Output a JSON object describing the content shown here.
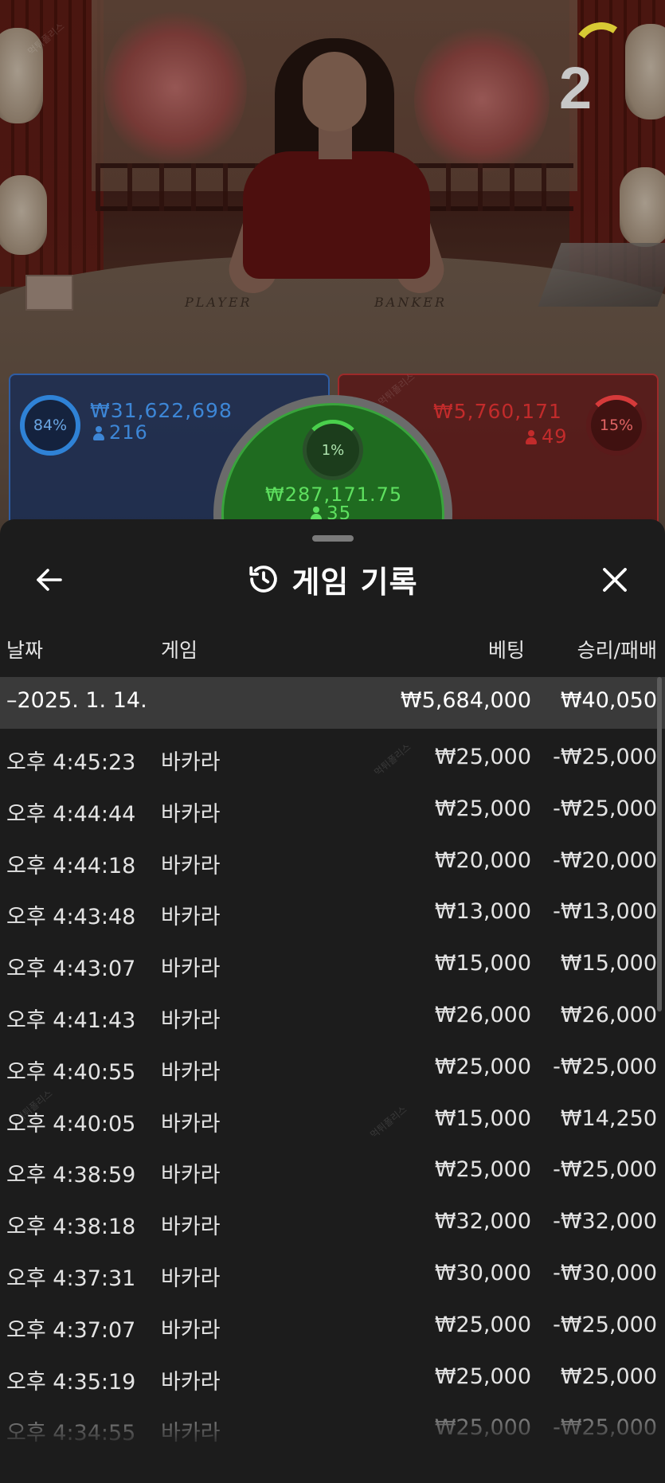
{
  "stream": {
    "round_number": "2",
    "table_labels": {
      "player": "PLAYER",
      "banker": "BANKER"
    }
  },
  "bets": {
    "player": {
      "percent": "84%",
      "amount": "₩31,622,698",
      "count": "216",
      "color": "#2f82d6"
    },
    "tie": {
      "percent": "1%",
      "amount": "₩287,171.75",
      "count": "35",
      "color": "#39a43c"
    },
    "banker": {
      "percent": "15%",
      "amount": "₩5,760,171",
      "count": "49",
      "color": "#c22b2b"
    }
  },
  "history": {
    "title": "게임 기록",
    "icons": {
      "back": "arrow-left-icon",
      "history": "history-icon",
      "close": "close-icon"
    },
    "columns": {
      "date": "날짜",
      "game": "게임",
      "bet": "베팅",
      "win_loss": "승리/패배"
    },
    "day_group": {
      "date": "–2025. 1. 14.",
      "bet": "₩5,684,000",
      "win_loss": "₩40,050"
    },
    "rows": [
      {
        "time": "오후 4:45:23",
        "game": "바카라",
        "bet": "₩25,000",
        "win_loss": "-₩25,000"
      },
      {
        "time": "오후 4:44:44",
        "game": "바카라",
        "bet": "₩25,000",
        "win_loss": "-₩25,000"
      },
      {
        "time": "오후 4:44:18",
        "game": "바카라",
        "bet": "₩20,000",
        "win_loss": "-₩20,000"
      },
      {
        "time": "오후 4:43:48",
        "game": "바카라",
        "bet": "₩13,000",
        "win_loss": "-₩13,000"
      },
      {
        "time": "오후 4:43:07",
        "game": "바카라",
        "bet": "₩15,000",
        "win_loss": "₩15,000"
      },
      {
        "time": "오후 4:41:43",
        "game": "바카라",
        "bet": "₩26,000",
        "win_loss": "₩26,000"
      },
      {
        "time": "오후 4:40:55",
        "game": "바카라",
        "bet": "₩25,000",
        "win_loss": "-₩25,000"
      },
      {
        "time": "오후 4:40:05",
        "game": "바카라",
        "bet": "₩15,000",
        "win_loss": "₩14,250"
      },
      {
        "time": "오후 4:38:59",
        "game": "바카라",
        "bet": "₩25,000",
        "win_loss": "-₩25,000"
      },
      {
        "time": "오후 4:38:18",
        "game": "바카라",
        "bet": "₩32,000",
        "win_loss": "-₩32,000"
      },
      {
        "time": "오후 4:37:31",
        "game": "바카라",
        "bet": "₩30,000",
        "win_loss": "-₩30,000"
      },
      {
        "time": "오후 4:37:07",
        "game": "바카라",
        "bet": "₩25,000",
        "win_loss": "-₩25,000"
      },
      {
        "time": "오후 4:35:19",
        "game": "바카라",
        "bet": "₩25,000",
        "win_loss": "₩25,000"
      },
      {
        "time": "오후 4:34:55",
        "game": "바카라",
        "bet": "₩25,000",
        "win_loss": "-₩25,000"
      }
    ]
  },
  "watermark": "먹튀폴리스"
}
